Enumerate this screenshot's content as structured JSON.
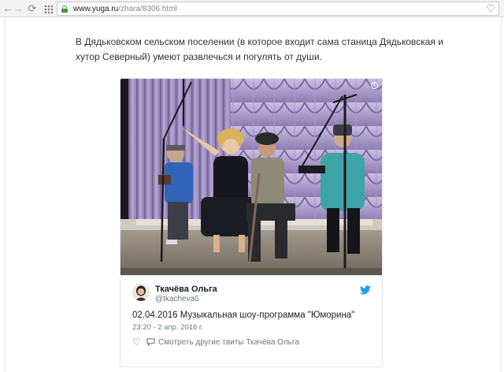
{
  "browser": {
    "url_domain": "www.yuga.ru",
    "url_path": "/zhara/8306.html",
    "icons": {
      "back": "arrow-left-icon",
      "forward": "arrow-right-icon",
      "reload": "reload-icon",
      "apps": "apps-grid-icon",
      "secure": "lock-icon",
      "bookmark": "heart-icon"
    }
  },
  "article": {
    "paragraph": "В Дядьковском сельском поселении (в которое входит сама станица Дядьковская и хутор Северный) умеют развлечься и погулять от души."
  },
  "tweet": {
    "author_name": "Ткачёва Ольга",
    "author_handle": "@tkacheva6",
    "text": "02.04.2016 Музыкальная шоу-программа \"Юморина\"",
    "meta": "23:20 - 2 апр. 2016 г.",
    "more_link": "Смотреть другие твиты Ткачёва Ольга",
    "colors": {
      "twitter_blue": "#1da1f2",
      "name": "#1c2022",
      "secondary": "#697882"
    }
  }
}
